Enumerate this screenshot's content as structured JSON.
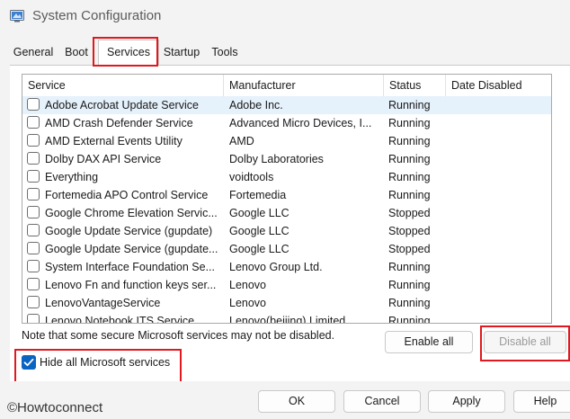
{
  "window": {
    "title": "System Configuration",
    "icon": "system-config-icon"
  },
  "tabs": [
    {
      "label": "General"
    },
    {
      "label": "Boot"
    },
    {
      "label": "Services",
      "active": true
    },
    {
      "label": "Startup"
    },
    {
      "label": "Tools"
    }
  ],
  "services_table": {
    "columns": [
      "Service",
      "Manufacturer",
      "Status",
      "Date Disabled"
    ],
    "rows": [
      {
        "service": "Adobe Acrobat Update Service",
        "manufacturer": "Adobe Inc.",
        "status": "Running",
        "date_disabled": ""
      },
      {
        "service": "AMD Crash Defender Service",
        "manufacturer": "Advanced Micro Devices, I...",
        "status": "Running",
        "date_disabled": ""
      },
      {
        "service": "AMD External Events Utility",
        "manufacturer": "AMD",
        "status": "Running",
        "date_disabled": ""
      },
      {
        "service": "Dolby DAX API Service",
        "manufacturer": "Dolby Laboratories",
        "status": "Running",
        "date_disabled": ""
      },
      {
        "service": "Everything",
        "manufacturer": "voidtools",
        "status": "Running",
        "date_disabled": ""
      },
      {
        "service": "Fortemedia APO Control Service",
        "manufacturer": "Fortemedia",
        "status": "Running",
        "date_disabled": ""
      },
      {
        "service": "Google Chrome Elevation Servic...",
        "manufacturer": "Google LLC",
        "status": "Stopped",
        "date_disabled": ""
      },
      {
        "service": "Google Update Service (gupdate)",
        "manufacturer": "Google LLC",
        "status": "Stopped",
        "date_disabled": ""
      },
      {
        "service": "Google Update Service (gupdate...",
        "manufacturer": "Google LLC",
        "status": "Stopped",
        "date_disabled": ""
      },
      {
        "service": "System Interface Foundation Se...",
        "manufacturer": "Lenovo Group Ltd.",
        "status": "Running",
        "date_disabled": ""
      },
      {
        "service": "Lenovo Fn and function keys ser...",
        "manufacturer": "Lenovo",
        "status": "Running",
        "date_disabled": ""
      },
      {
        "service": "LenovoVantageService",
        "manufacturer": "Lenovo",
        "status": "Running",
        "date_disabled": ""
      },
      {
        "service": "Lenovo Notebook ITS Service",
        "manufacturer": "Lenovo(beijing) Limited",
        "status": "Running",
        "date_disabled": ""
      }
    ]
  },
  "note": "Note that some secure Microsoft services may not be disabled.",
  "buttons": {
    "enable_all": "Enable all",
    "disable_all": "Disable all",
    "ok": "OK",
    "cancel": "Cancel",
    "apply": "Apply",
    "help": "Help"
  },
  "hide_microsoft": {
    "label": "Hide all Microsoft services",
    "checked": true
  },
  "watermark": "©Howtoconnect",
  "colors": {
    "highlight_red": "#e0191e",
    "checkbox_blue": "#0a64c2",
    "selected_row": "#e5f1fb"
  }
}
